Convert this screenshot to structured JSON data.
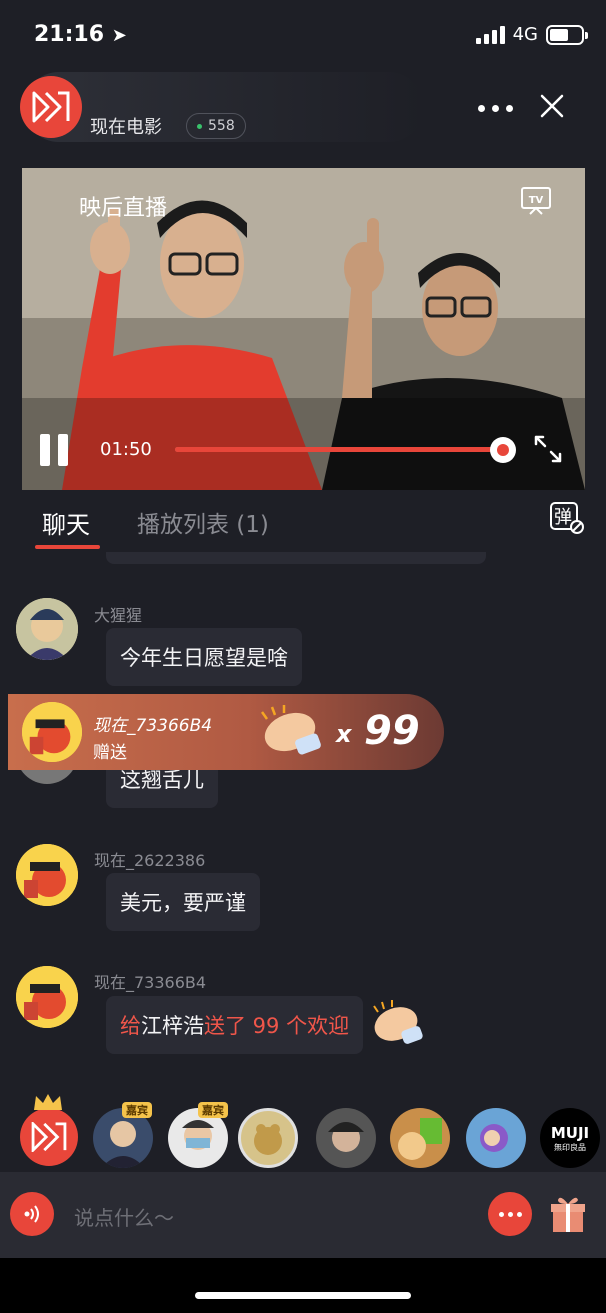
{
  "status": {
    "time": "21:16",
    "network": "4G"
  },
  "header": {
    "channel_name": "现在电影",
    "viewers": "558"
  },
  "video": {
    "title": "映后直播",
    "elapsed": "01:50",
    "progress": 0.98
  },
  "tabs": [
    {
      "label": "聊天"
    },
    {
      "label": "播放列表 (1)"
    }
  ],
  "danmaku_icon_label": "弹",
  "chat": [
    {
      "user": "大猩猩",
      "text": "今年生日愿望是啥"
    },
    {
      "user": "",
      "text": "这翘舌儿"
    },
    {
      "user": "现在_2622386",
      "text": "美元，要严谨"
    },
    {
      "user": "现在_73366B4",
      "text_pre": "给",
      "text_name": "江梓浩",
      "text_post": "送了 99 个欢迎"
    }
  ],
  "gift_banner": {
    "user": "现在_73366B4",
    "action": "赠送",
    "x": "x",
    "count": "99"
  },
  "audience": {
    "vip_label": "嘉宾",
    "brand": "MUJI",
    "brand_sub": "無印良品"
  },
  "input": {
    "placeholder": "说点什么～"
  },
  "colors": {
    "accent": "#e8463a",
    "background": "#1e1f26",
    "bubble": "#2a2b34"
  }
}
